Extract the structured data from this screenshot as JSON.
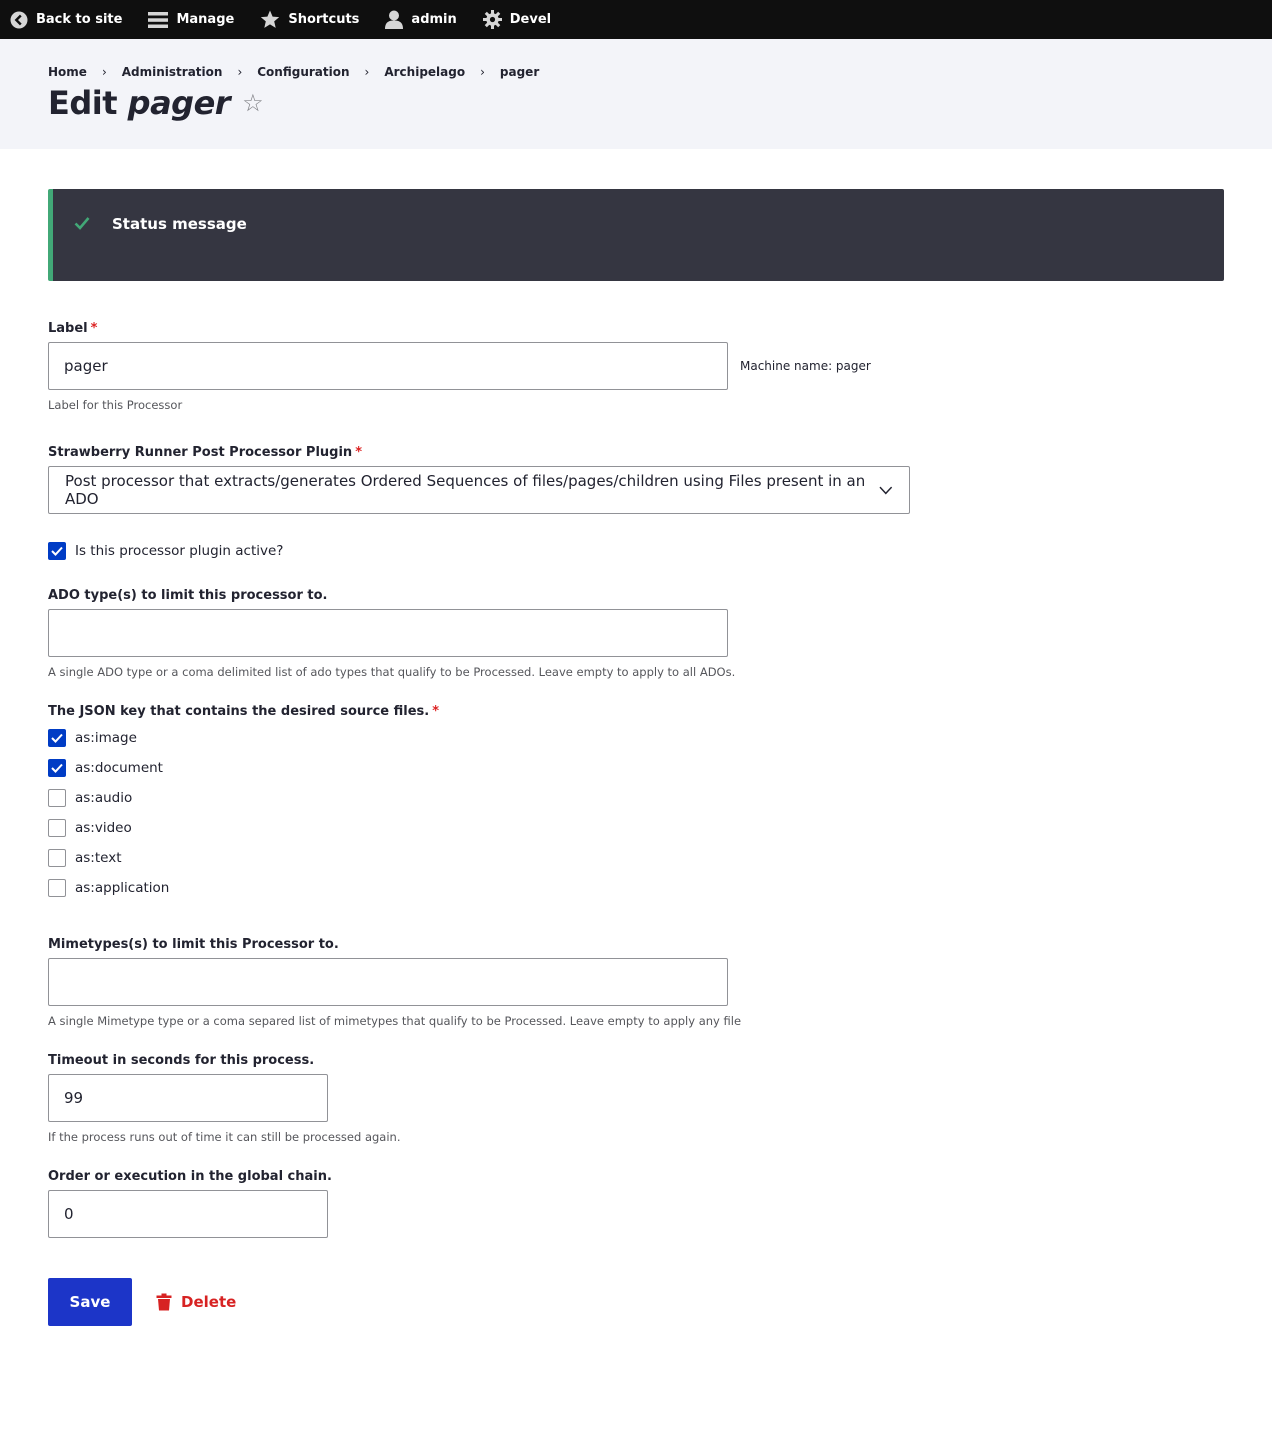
{
  "toolbar": {
    "items": [
      {
        "label": "Back to site",
        "icon": "back-arrow-icon"
      },
      {
        "label": "Manage",
        "icon": "hamburger-icon"
      },
      {
        "label": "Shortcuts",
        "icon": "star-icon"
      },
      {
        "label": "admin",
        "icon": "user-icon"
      },
      {
        "label": "Devel",
        "icon": "gear-icon"
      }
    ]
  },
  "breadcrumb": [
    "Home",
    "Administration",
    "Configuration",
    "Archipelago",
    "pager"
  ],
  "breadcrumb_separator": "›",
  "page": {
    "title_prefix": "Edit",
    "title_entity": "pager",
    "shortcut_star": "☆"
  },
  "status": {
    "title": "Status message",
    "accent_color": "#42a877"
  },
  "form": {
    "label": {
      "title": "Label",
      "required_mark": "*",
      "value": "pager",
      "machine_name": "Machine name: pager",
      "description": "Label for this Processor"
    },
    "plugin": {
      "title": "Strawberry Runner Post Processor Plugin",
      "required_mark": "*",
      "selected": "Post processor that extracts/generates Ordered Sequences of files/pages/children using Files present in an ADO"
    },
    "active": {
      "label": "Is this processor plugin active?",
      "checked": true
    },
    "ado_types": {
      "title": "ADO type(s) to limit this processor to.",
      "value": "",
      "description": "A single ADO type or a coma delimited list of ado types that qualify to be Processed. Leave empty to apply to all ADOs."
    },
    "json_key": {
      "title": "The JSON key that contains the desired source files.",
      "required_mark": "*",
      "options": [
        {
          "label": "as:image",
          "checked": true
        },
        {
          "label": "as:document",
          "checked": true
        },
        {
          "label": "as:audio",
          "checked": false
        },
        {
          "label": "as:video",
          "checked": false
        },
        {
          "label": "as:text",
          "checked": false
        },
        {
          "label": "as:application",
          "checked": false
        }
      ]
    },
    "mimetypes": {
      "title": "Mimetypes(s) to limit this Processor to.",
      "value": "",
      "description": "A single Mimetype type or a coma separed list of mimetypes that qualify to be Processed. Leave empty to apply any file"
    },
    "timeout": {
      "title": "Timeout in seconds for this process.",
      "value": "99",
      "description": "If the process runs out of time it can still be processed again."
    },
    "order": {
      "title": "Order or execution in the global chain.",
      "value": "0"
    }
  },
  "actions": {
    "save": "Save",
    "delete": "Delete"
  },
  "colors": {
    "primary": "#1c35c8",
    "checkbox": "#003cc5",
    "danger": "#d72222",
    "toolbar": "#0f0f0f",
    "status_bg": "#353641"
  }
}
